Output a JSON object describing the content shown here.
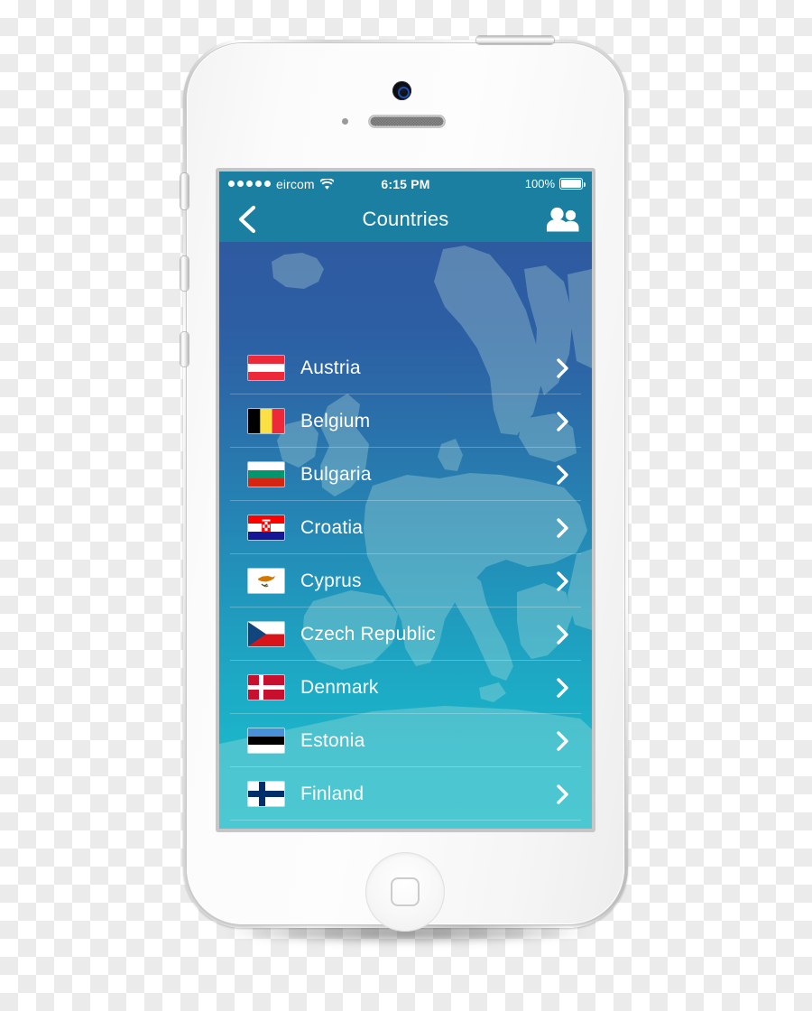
{
  "device": {
    "name": "iphone-5s-white",
    "buttons": {
      "mute_switch": "Mute switch",
      "volume_up": "Volume up",
      "volume_down": "Volume down",
      "power": "Power / Sleep",
      "home": "Home"
    },
    "hardware": {
      "front_camera": "Front camera",
      "proximity_sensor": "Proximity sensor",
      "earpiece": "Earpiece speaker"
    }
  },
  "status_bar": {
    "signal_dots_filled": 5,
    "signal_dots_total": 5,
    "carrier": "eircom",
    "wifi_icon": "wifi-icon",
    "time": "6:15 PM",
    "battery_percent": "100%",
    "battery_level": 100
  },
  "nav_bar": {
    "back_icon": "chevron-left-icon",
    "title": "Countries",
    "contacts_icon": "people-icon",
    "background_color": "#1a7fa0"
  },
  "screen": {
    "background_gradient_top": "#2e5aa0",
    "background_gradient_bottom": "#1abccd",
    "map_background": "europe-map"
  },
  "country_list": {
    "chevron_icon": "chevron-right-icon",
    "items": [
      {
        "name": "Austria",
        "flag": "flag-austria",
        "colors": [
          "#ed2939",
          "#ffffff",
          "#ed2939"
        ]
      },
      {
        "name": "Belgium",
        "flag": "flag-belgium",
        "colors": [
          "#000000",
          "#fae042",
          "#ed2939"
        ]
      },
      {
        "name": "Bulgaria",
        "flag": "flag-bulgaria",
        "colors": [
          "#ffffff",
          "#00966e",
          "#d62612"
        ]
      },
      {
        "name": "Croatia",
        "flag": "flag-croatia",
        "colors": [
          "#ff0000",
          "#ffffff",
          "#171796"
        ]
      },
      {
        "name": "Cyprus",
        "flag": "flag-cyprus",
        "colors": [
          "#ffffff",
          "#d57800",
          "#4e5b31"
        ]
      },
      {
        "name": "Czech Republic",
        "flag": "flag-czech-republic",
        "colors": [
          "#ffffff",
          "#d7141a",
          "#11457e"
        ]
      },
      {
        "name": "Denmark",
        "flag": "flag-denmark",
        "colors": [
          "#c8102e",
          "#ffffff"
        ]
      },
      {
        "name": "Estonia",
        "flag": "flag-estonia",
        "colors": [
          "#4891d9",
          "#000000",
          "#ffffff"
        ]
      },
      {
        "name": "Finland",
        "flag": "flag-finland",
        "colors": [
          "#ffffff",
          "#002f6c"
        ]
      }
    ]
  }
}
